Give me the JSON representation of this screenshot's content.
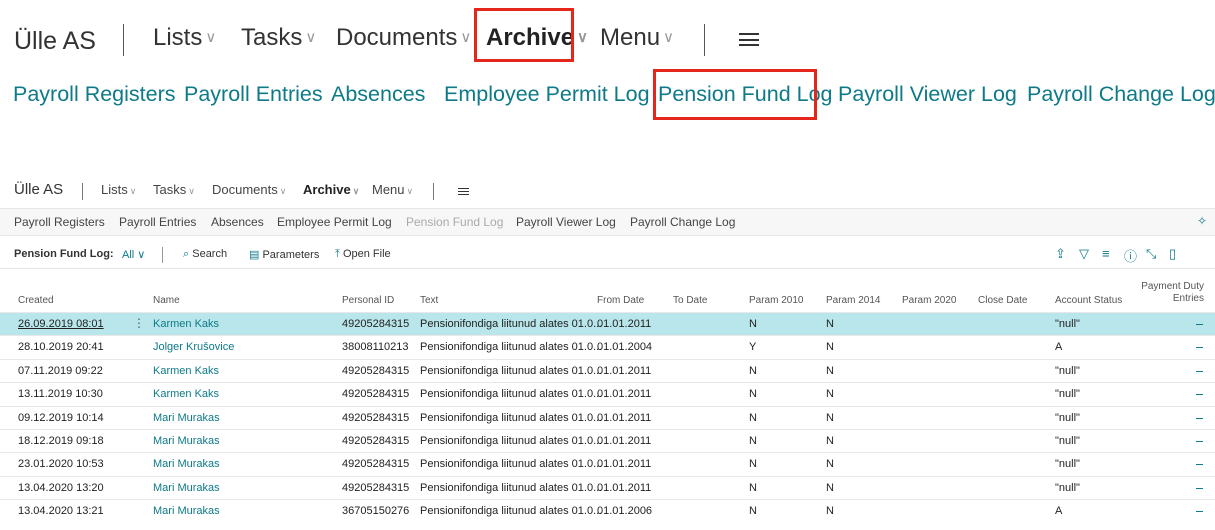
{
  "zoom_nav": {
    "company": "Ülle AS",
    "lists": "Lists",
    "tasks": "Tasks",
    "documents": "Documents",
    "archive": "Archive",
    "menu": "Menu",
    "chevron": "∨"
  },
  "zoom_actions": [
    "Payroll Registers",
    "Payroll Entries",
    "Absences",
    "Employee Permit Log",
    "Pension Fund Log",
    "Payroll Viewer Log",
    "Payroll Change Log"
  ],
  "nav": {
    "company": "Ülle AS",
    "lists": "Lists",
    "tasks": "Tasks",
    "documents": "Documents",
    "archive": "Archive",
    "menu": "Menu",
    "chevron": "∨"
  },
  "actions": [
    "Payroll Registers",
    "Payroll Entries",
    "Absences",
    "Employee Permit Log",
    "Pension Fund Log",
    "Payroll Viewer Log",
    "Payroll Change Log"
  ],
  "toolbar": {
    "page_label": "Pension Fund Log:",
    "filter": "All",
    "search": "Search",
    "parameters": "Parameters",
    "open_file": "Open File"
  },
  "columns": {
    "created": "Created",
    "name": "Name",
    "personal_id": "Personal ID",
    "text": "Text",
    "from_date": "From Date",
    "to_date": "To Date",
    "param2010": "Param 2010",
    "param2014": "Param 2014",
    "param2020": "Param 2020",
    "close_date": "Close Date",
    "account_status": "Account Status",
    "payment_duty_1": "Payment Duty",
    "payment_duty_2": "Entries"
  },
  "rows": [
    {
      "created": "26.09.2019 08:01",
      "name": "Karmen Kaks",
      "pid": "49205284315",
      "text": "Pensionifondiga liitunud alates 01.0...",
      "from": "01.01.2011",
      "p2010": "N",
      "p2014": "N",
      "status": "\"null\""
    },
    {
      "created": "28.10.2019 20:41",
      "name": "Jolger Krušovice",
      "pid": "38008110213",
      "text": "Pensionifondiga liitunud alates 01.0...",
      "from": "01.01.2004",
      "p2010": "Y",
      "p2014": "N",
      "status": "A"
    },
    {
      "created": "07.11.2019 09:22",
      "name": "Karmen Kaks",
      "pid": "49205284315",
      "text": "Pensionifondiga liitunud alates 01.0...",
      "from": "01.01.2011",
      "p2010": "N",
      "p2014": "N",
      "status": "\"null\""
    },
    {
      "created": "13.11.2019 10:30",
      "name": "Karmen Kaks",
      "pid": "49205284315",
      "text": "Pensionifondiga liitunud alates 01.0...",
      "from": "01.01.2011",
      "p2010": "N",
      "p2014": "N",
      "status": "\"null\""
    },
    {
      "created": "09.12.2019 10:14",
      "name": "Mari Murakas",
      "pid": "49205284315",
      "text": "Pensionifondiga liitunud alates 01.0...",
      "from": "01.01.2011",
      "p2010": "N",
      "p2014": "N",
      "status": "\"null\""
    },
    {
      "created": "18.12.2019 09:18",
      "name": "Mari Murakas",
      "pid": "49205284315",
      "text": "Pensionifondiga liitunud alates 01.0...",
      "from": "01.01.2011",
      "p2010": "N",
      "p2014": "N",
      "status": "\"null\""
    },
    {
      "created": "23.01.2020 10:53",
      "name": "Mari Murakas",
      "pid": "49205284315",
      "text": "Pensionifondiga liitunud alates 01.0...",
      "from": "01.01.2011",
      "p2010": "N",
      "p2014": "N",
      "status": "\"null\""
    },
    {
      "created": "13.04.2020 13:20",
      "name": "Mari Murakas",
      "pid": "49205284315",
      "text": "Pensionifondiga liitunud alates 01.0...",
      "from": "01.01.2011",
      "p2010": "N",
      "p2014": "N",
      "status": "\"null\""
    },
    {
      "created": "13.04.2020 13:21",
      "name": "Mari Murakas",
      "pid": "36705150276",
      "text": "Pensionifondiga liitunud alates 01.0...",
      "from": "01.01.2006",
      "p2010": "N",
      "p2014": "N",
      "status": "A"
    }
  ],
  "row_menu_glyph": "⋮",
  "colors": {
    "accent": "#0e7a88",
    "highlight": "#e5261b",
    "selected_row": "#b8e6ea"
  },
  "icons": [
    "search-icon",
    "parameters-icon",
    "open-file-icon",
    "share-icon",
    "filter-icon",
    "list-view-icon",
    "info-icon",
    "collapse-icon",
    "bookmark-icon",
    "pin-icon"
  ]
}
